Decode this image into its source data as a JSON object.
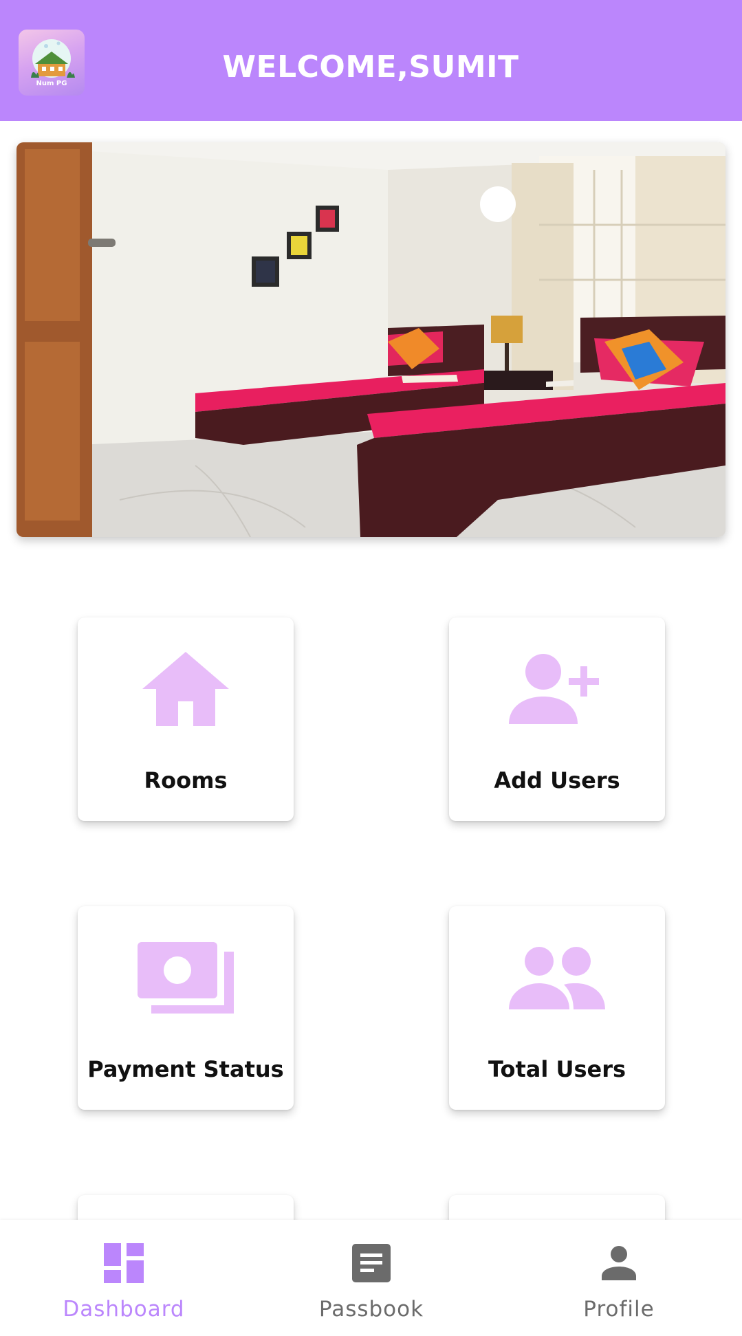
{
  "colors": {
    "primary": "#bb86fc",
    "icon_tint": "#e8bdf9",
    "inactive": "#6b6b6b",
    "label_text": "#111111"
  },
  "header": {
    "logo_text": "Num PG",
    "title": "WELCOME,SUMIT"
  },
  "hero": {
    "icon": "room-photo"
  },
  "tiles": [
    {
      "label": "Rooms",
      "icon": "home-icon"
    },
    {
      "label": "Add Users",
      "icon": "person-add-icon"
    },
    {
      "label": "Payment Status",
      "icon": "payments-icon"
    },
    {
      "label": "Total Users",
      "icon": "people-icon"
    }
  ],
  "bottom_nav": {
    "items": [
      {
        "label": "Dashboard",
        "icon": "dashboard-icon",
        "active": true
      },
      {
        "label": "Passbook",
        "icon": "passbook-icon",
        "active": false
      },
      {
        "label": "Profile",
        "icon": "profile-icon",
        "active": false
      }
    ]
  }
}
